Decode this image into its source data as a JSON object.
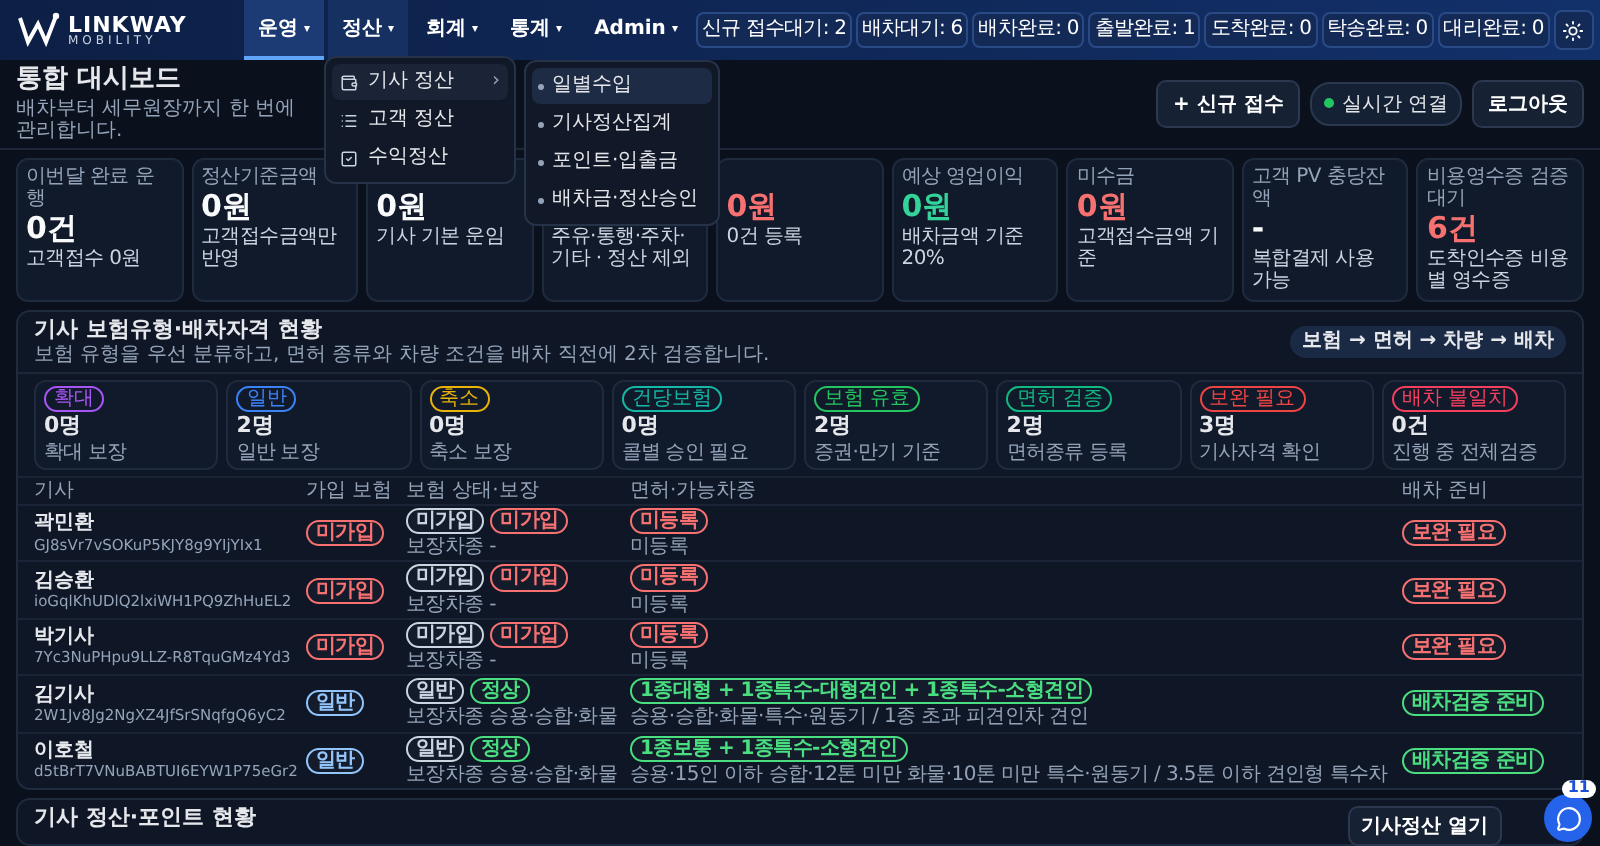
{
  "brand": {
    "name": "LINKWAY",
    "tagline": "MOBILITY"
  },
  "nav": [
    {
      "label": "운영",
      "caret": "▾",
      "selected": true,
      "expanded": false
    },
    {
      "label": "정산",
      "caret": "▾",
      "selected": false,
      "expanded": true
    },
    {
      "label": "회계",
      "caret": "▾",
      "selected": false,
      "expanded": false
    },
    {
      "label": "통계",
      "caret": "▾",
      "selected": false,
      "expanded": false
    },
    {
      "label": "Admin",
      "caret": "▾",
      "selected": false,
      "expanded": false
    }
  ],
  "status_badges": [
    "신규 접수대기: 2",
    "배차대기: 6",
    "배차완료: 0",
    "출발완료: 1",
    "도착완료: 0",
    "탁송완료: 0",
    "대리완료: 0"
  ],
  "menu": [
    {
      "label": "기사 정산",
      "arrow": "›",
      "expanded": true
    },
    {
      "label": "고객 정산",
      "expanded": false
    },
    {
      "label": "수익정산",
      "expanded": false
    }
  ],
  "submenu": [
    {
      "label": "일별수입",
      "selected": true
    },
    {
      "label": "기사정산집계",
      "selected": false
    },
    {
      "label": "포인트·입출금",
      "selected": false
    },
    {
      "label": "배차금·정산승인",
      "selected": false
    }
  ],
  "header": {
    "title": "통합 대시보드",
    "subtitle": "배차부터 세무원장까지 한 번에 관리합니다.",
    "new_button": "+ 신규 접수",
    "live": {
      "label": "실시간 연결",
      "on": true
    },
    "logout": "로그아웃"
  },
  "stats": [
    {
      "label": "이번달 완료 운행",
      "value": "0건",
      "note": "고객접수 0원"
    },
    {
      "label": "정산기준금액",
      "value": "0원",
      "note": "고객접수금액만 반영"
    },
    {
      "value": "0원",
      "note": "기사 기본 운임"
    },
    {
      "note": "주유·통행·주차·기타 · 정산 제외"
    },
    {
      "value": "0원",
      "color": "#f87171",
      "note": "0건 등록"
    },
    {
      "label": "예상 영업이익",
      "value": "0원",
      "color": "#34d399",
      "note": "배차금액 기준 20%"
    },
    {
      "label": "미수금",
      "value": "0원",
      "color": "#f87171",
      "note": "고객접수금액 기준"
    },
    {
      "label": "고객 PV 충당잔액",
      "value": "-",
      "note": "복합결제 사용 가능"
    },
    {
      "label": "비용영수증 검증대기",
      "value": "6건",
      "color": "#f87171",
      "note": "도착인수증 비용별 영수증"
    }
  ],
  "insurance": {
    "title": "기사 보험유형·배차자격 현황",
    "subtitle": "보험 유형을 우선 분류하고, 면허 종류와 차량 조건을 배차 직전에 2차 검증합니다.",
    "flow": "보험 → 면허 → 차량 → 배차",
    "summary": [
      {
        "tag": "확대",
        "color": "#a855f7",
        "count": "0명",
        "note": "확대 보장"
      },
      {
        "tag": "일반",
        "color": "#3b82f6",
        "count": "2명",
        "note": "일반 보장"
      },
      {
        "tag": "축소",
        "color": "#eab308",
        "count": "0명",
        "note": "축소 보장"
      },
      {
        "tag": "건당보험",
        "color": "#14b8a6",
        "count": "0명",
        "note": "콜별 승인 필요"
      },
      {
        "tag": "보험 유효",
        "color": "#22c55e",
        "count": "2명",
        "note": "증권·만기 기준"
      },
      {
        "tag": "면허 검증",
        "color": "#10b981",
        "count": "2명",
        "note": "면허종류 등록"
      },
      {
        "tag": "보완 필요",
        "color": "#ef4444",
        "count": "3명",
        "note": "기사자격 확인"
      },
      {
        "tag": "배차 불일치",
        "color": "#f43f5e",
        "count": "0건",
        "note": "진행 중 전체검증"
      }
    ],
    "columns": [
      "기사",
      "가입 보험",
      "보험 상태·보장",
      "면허·가능차종",
      "배차 준비"
    ],
    "rows": [
      {
        "name": "곽민환",
        "uid": "GJ8sVr7vSOKuP5KJY8g9YIjYIx1",
        "insurance": {
          "label": "미가입",
          "color": "#f87171"
        },
        "coverage": {
          "tags": [
            {
              "label": "미가입",
              "color": "#cbd5e1"
            },
            {
              "label": "미가입",
              "color": "#f87171"
            }
          ],
          "note": "보장차종 -"
        },
        "license": {
          "tags": [
            {
              "label": "미등록",
              "color": "#f87171"
            }
          ],
          "note": "미등록"
        },
        "ready": {
          "label": "보완 필요",
          "color": "#f87171"
        }
      },
      {
        "name": "김승환",
        "uid": "ioGqlKhUDlQ2lxiWH1PQ9ZhHuEL2",
        "insurance": {
          "label": "미가입",
          "color": "#f87171"
        },
        "coverage": {
          "tags": [
            {
              "label": "미가입",
              "color": "#cbd5e1"
            },
            {
              "label": "미가입",
              "color": "#f87171"
            }
          ],
          "note": "보장차종 -"
        },
        "license": {
          "tags": [
            {
              "label": "미등록",
              "color": "#f87171"
            }
          ],
          "note": "미등록"
        },
        "ready": {
          "label": "보완 필요",
          "color": "#f87171"
        }
      },
      {
        "name": "박기사",
        "uid": "7Yc3NuPHpu9LLZ-R8TquGMz4Yd3",
        "insurance": {
          "label": "미가입",
          "color": "#f87171"
        },
        "coverage": {
          "tags": [
            {
              "label": "미가입",
              "color": "#cbd5e1"
            },
            {
              "label": "미가입",
              "color": "#f87171"
            }
          ],
          "note": "보장차종 -"
        },
        "license": {
          "tags": [
            {
              "label": "미등록",
              "color": "#f87171"
            }
          ],
          "note": "미등록"
        },
        "ready": {
          "label": "보완 필요",
          "color": "#f87171"
        }
      },
      {
        "name": "김기사",
        "uid": "2W1Jv8Jg2NgXZ4JfSrSNqfgQ6yC2",
        "insurance": {
          "label": "일반",
          "color": "#93c5fd"
        },
        "coverage": {
          "tags": [
            {
              "label": "일반",
              "color": "#cbd5e1"
            },
            {
              "label": "정상",
              "color": "#4ade80"
            }
          ],
          "note": "보장차종 승용·승합·화물"
        },
        "license": {
          "tags": [
            {
              "label": "1종대형 + 1종특수-대형견인 + 1종특수-소형견인",
              "color": "#4ade80"
            }
          ],
          "note": "승용·승합·화물·특수·원동기 / 1종 초과 피견인차 견인"
        },
        "ready": {
          "label": "배차검증 준비",
          "color": "#4ade80"
        }
      },
      {
        "name": "이호철",
        "uid": "d5tBrT7VNuBABTUI6EYW1P75eGr2",
        "insurance": {
          "label": "일반",
          "color": "#93c5fd"
        },
        "coverage": {
          "tags": [
            {
              "label": "일반",
              "color": "#cbd5e1"
            },
            {
              "label": "정상",
              "color": "#4ade80"
            }
          ],
          "note": "보장차종 승용·승합·화물"
        },
        "license": {
          "tags": [
            {
              "label": "1종보통 + 1종특수-소형견인",
              "color": "#4ade80"
            }
          ],
          "note": "승용·15인 이하 승합·12톤 미만 화물·10톤 미만 특수·원동기 / 3.5톤 이하 견인형 특수차"
        },
        "ready": {
          "label": "배차검증 준비",
          "color": "#4ade80"
        }
      }
    ]
  },
  "settlement": {
    "title": "기사 정산·포인트 현황",
    "button": "기사정산 열기"
  },
  "chat": {
    "badge": "11"
  }
}
